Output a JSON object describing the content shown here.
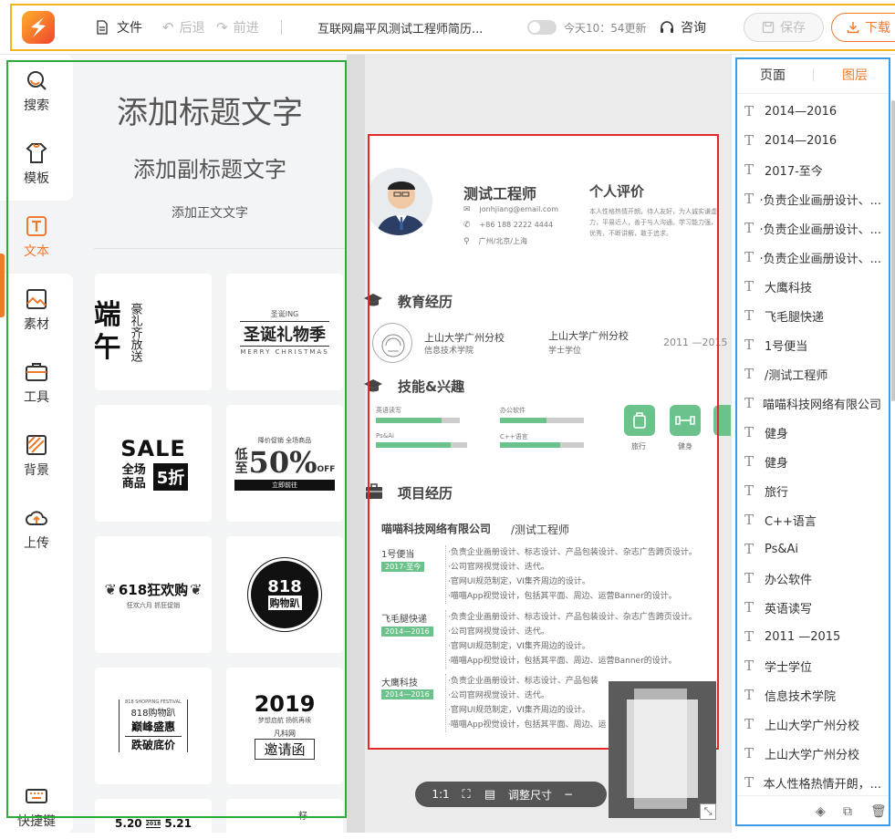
{
  "topbar": {
    "file": "文件",
    "undo": "后退",
    "redo": "前进",
    "doc_title": "互联网扁平风测试工程师简历...",
    "autosave": "今天10：54更新",
    "consult": "咨询",
    "save": "保存",
    "download": "下载"
  },
  "nav": {
    "search": "搜索",
    "template": "模板",
    "text": "文本",
    "material": "素材",
    "tools": "工具",
    "background": "背景",
    "upload": "上传",
    "shortcuts": "快捷键"
  },
  "panel": {
    "heading": "添加标题文字",
    "subheading": "添加副标题文字",
    "body": "添加正文文字",
    "templates": [
      {
        "lines": [
          "端",
          "午",
          "豪礼齐放送"
        ]
      },
      {
        "lines": [
          "圣诞ING",
          "圣诞礼物季",
          "MERRY CHRISTMAS"
        ]
      },
      {
        "lines": [
          "SALE",
          "全场商品",
          "5折"
        ]
      },
      {
        "lines": [
          "降价促销 全场商品",
          "低至",
          "50%",
          "OFF",
          "立即前往"
        ]
      },
      {
        "lines": [
          "618狂欢购",
          "狂欢六月 抓狂促销"
        ]
      },
      {
        "lines": [
          "818",
          "购物趴"
        ]
      },
      {
        "lines": [
          "818 SHOPPING FESTIVAL",
          "818购物趴",
          "巅峰盛惠",
          "跌破底价"
        ]
      },
      {
        "lines": [
          "2019",
          "梦想启航 扬帆再续",
          "凡科网",
          "邀请函"
        ]
      },
      {
        "lines": [
          "5.20",
          "2018",
          "5.21"
        ]
      },
      {
        "lines": [
          "籽"
        ]
      }
    ]
  },
  "resume": {
    "name": "测试工程师",
    "email": "jonhjiang@email.com",
    "phone": "+86 188 2222 4444",
    "location": "广州/北京/上海",
    "eval_title": "个人评价",
    "eval_text": [
      "本人性格热情开朗，待人友好，为人诚实谦虚。工作勤奋，认真负责，能吃苦耐劳，尽职尽责，具有耐心。有",
      "力，平易近人，善于与人沟通。学习能力强，具备团队协作",
      "优秀，不断讲解，敢于追求。"
    ],
    "edu_title": "教育经历",
    "school1": "上山大学广州分校",
    "college": "信息技术学院",
    "school2": "上山大学广州分校",
    "degree": "学士学位",
    "edu_years": "2011 —2015",
    "skills_title": "技能&兴趣",
    "skills": [
      {
        "name": "英语读写",
        "level": 0.78
      },
      {
        "name": "办公软件",
        "level": 0.55
      },
      {
        "name": "Ps&Ai",
        "level": 0.82
      },
      {
        "name": "C++语言",
        "level": 0.72
      }
    ],
    "interests": [
      "旅行",
      "健身"
    ],
    "proj_title": "项目经历",
    "company": "喵喵科技网络有限公司",
    "role": "/测试工程师",
    "projects": [
      {
        "name": "1号便当",
        "period": "2017-至今"
      },
      {
        "name": "飞毛腿快递",
        "period": "2014—2016"
      },
      {
        "name": "大鹰科技",
        "period": "2014—2016"
      }
    ],
    "bullets_full": [
      "·负责企业画册设计、标志设计、产品包装设计、杂志广告跨页设计。",
      "·公司官网视觉设计、迭代。",
      "·官网UI规范制定，VI集齐周边的设计。",
      "·喵喵App视觉设计，包括其平面、周边、运营Banner的设计。"
    ],
    "bullets_short": [
      "·负责企业画册设计、标志设计、产品包装",
      "·公司官网视觉设计、迭代。",
      "·官网UI规范制定，VI集齐周边的设计。",
      "·喵喵App视觉设计，包括其平面、周边、运"
    ]
  },
  "zoombar": {
    "ratio": "1:1",
    "resize": "调整尺寸"
  },
  "right": {
    "tab_page": "页面",
    "tab_layer": "图层",
    "layers": [
      "2014—2016",
      "2014—2016",
      "2017-至今",
      "·负责企业画册设计、...",
      "·负责企业画册设计、...",
      "·负责企业画册设计、...",
      "大鹰科技",
      "飞毛腿快递",
      "1号便当",
      "/测试工程师",
      "喵喵科技网络有限公司",
      "健身",
      "健身",
      "旅行",
      "C++语言",
      "Ps&Ai",
      "办公软件",
      "英语读写",
      "2011 —2015",
      "学士学位",
      "信息技术学院",
      "上山大学广州分校",
      "上山大学广州分校",
      "本人性格热情开朗，..."
    ]
  },
  "colors": {
    "accent": "#f07a2c",
    "green": "#6bc28a",
    "frame_yellow": "#f2b61c",
    "frame_green": "#2eaa3a",
    "frame_red": "#e2282a",
    "frame_blue": "#3c9de6"
  }
}
